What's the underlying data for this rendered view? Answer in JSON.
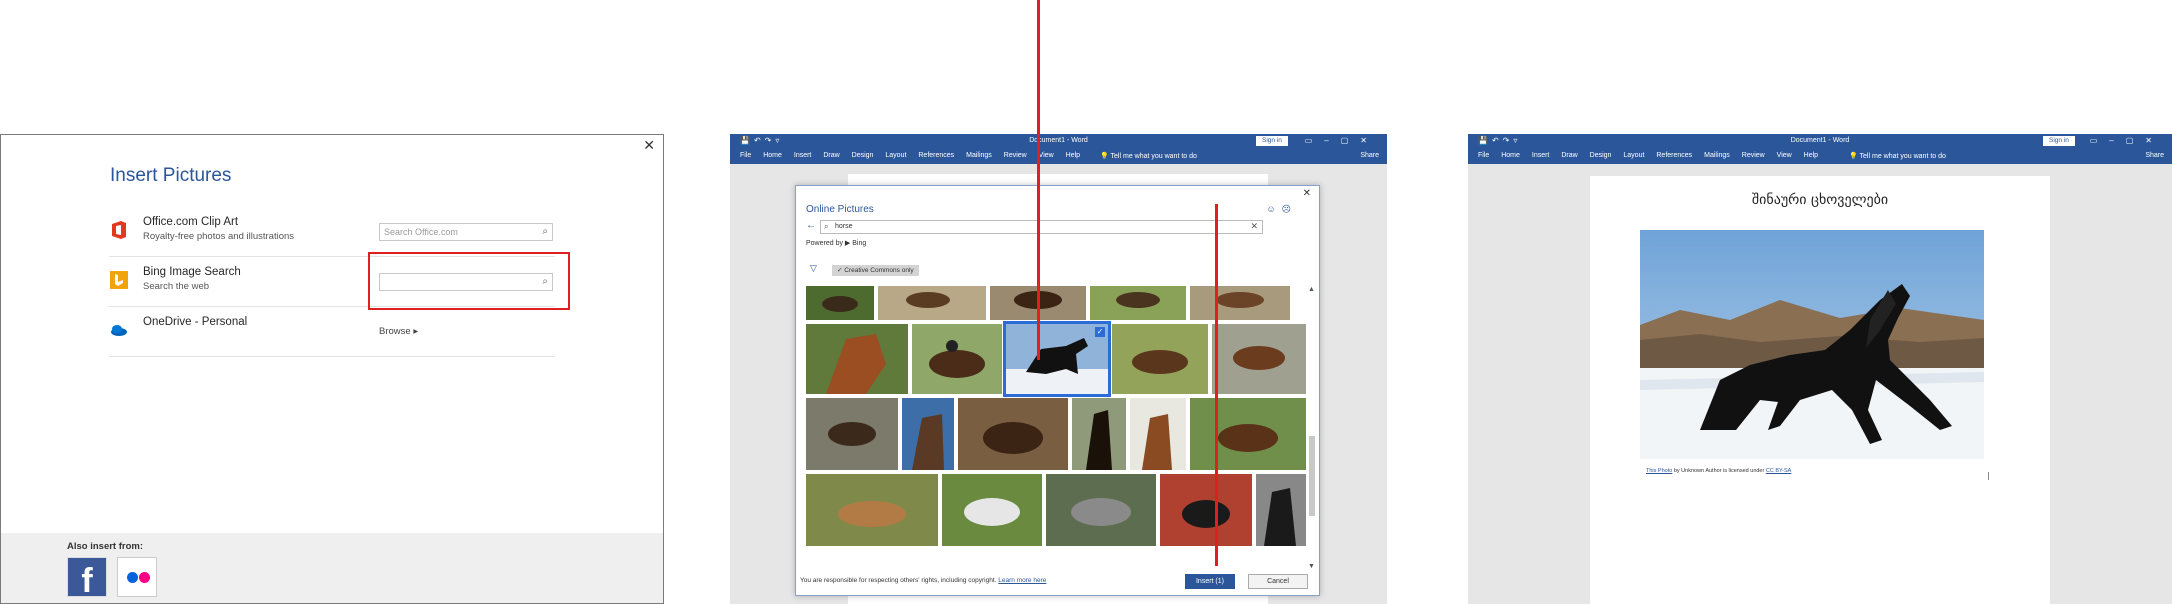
{
  "panel1": {
    "title": "Insert Pictures",
    "close_glyph": "✕",
    "rows": [
      {
        "name": "Office.com Clip Art",
        "sub": "Royalty-free photos and illustrations",
        "icon": "office-icon",
        "search_placeholder": "Search Office.com"
      },
      {
        "name": "Bing Image Search",
        "sub": "Search the web",
        "icon": "bing-icon",
        "search_placeholder": ""
      },
      {
        "name": "OneDrive - Personal",
        "sub": "",
        "icon": "onedrive-icon",
        "browse": "Browse ▸"
      }
    ],
    "also_insert_label": "Also insert from:",
    "facebook_glyph": "f",
    "highlight_color": "#e02020"
  },
  "panel2": {
    "word_title": "Document1  -  Word",
    "sign_in": "Sign in",
    "tabs": [
      "File",
      "Home",
      "Insert",
      "Draw",
      "Design",
      "Layout",
      "References",
      "Mailings",
      "Review",
      "View",
      "Help"
    ],
    "tell_me": "💡 Tell me what you want to do",
    "share": "Share",
    "dialog": {
      "title": "Online Pictures",
      "query": "horse",
      "powered_by": "Powered by ▶ Bing",
      "filter_label": "Creative Commons only",
      "disclaimer": "You are responsible for respecting others' rights, including copyright.",
      "learn_more": "Learn more here",
      "insert_label": "Insert (1)",
      "cancel_label": "Cancel"
    }
  },
  "panel3": {
    "word_title": "Document1  -  Word",
    "sign_in": "Sign in",
    "tabs": [
      "File",
      "Home",
      "Insert",
      "Draw",
      "Design",
      "Layout",
      "References",
      "Mailings",
      "Review",
      "View",
      "Help"
    ],
    "tell_me": "💡 Tell me what you want to do",
    "share": "Share",
    "doc_title": "შინაური ცხოველები",
    "caption_link": "This Photo",
    "caption_mid": " by Unknown Author is licensed under ",
    "caption_license": "CC BY-SA"
  },
  "colors": {
    "word_blue": "#2b579a",
    "annotation_red": "#e21e1e"
  }
}
